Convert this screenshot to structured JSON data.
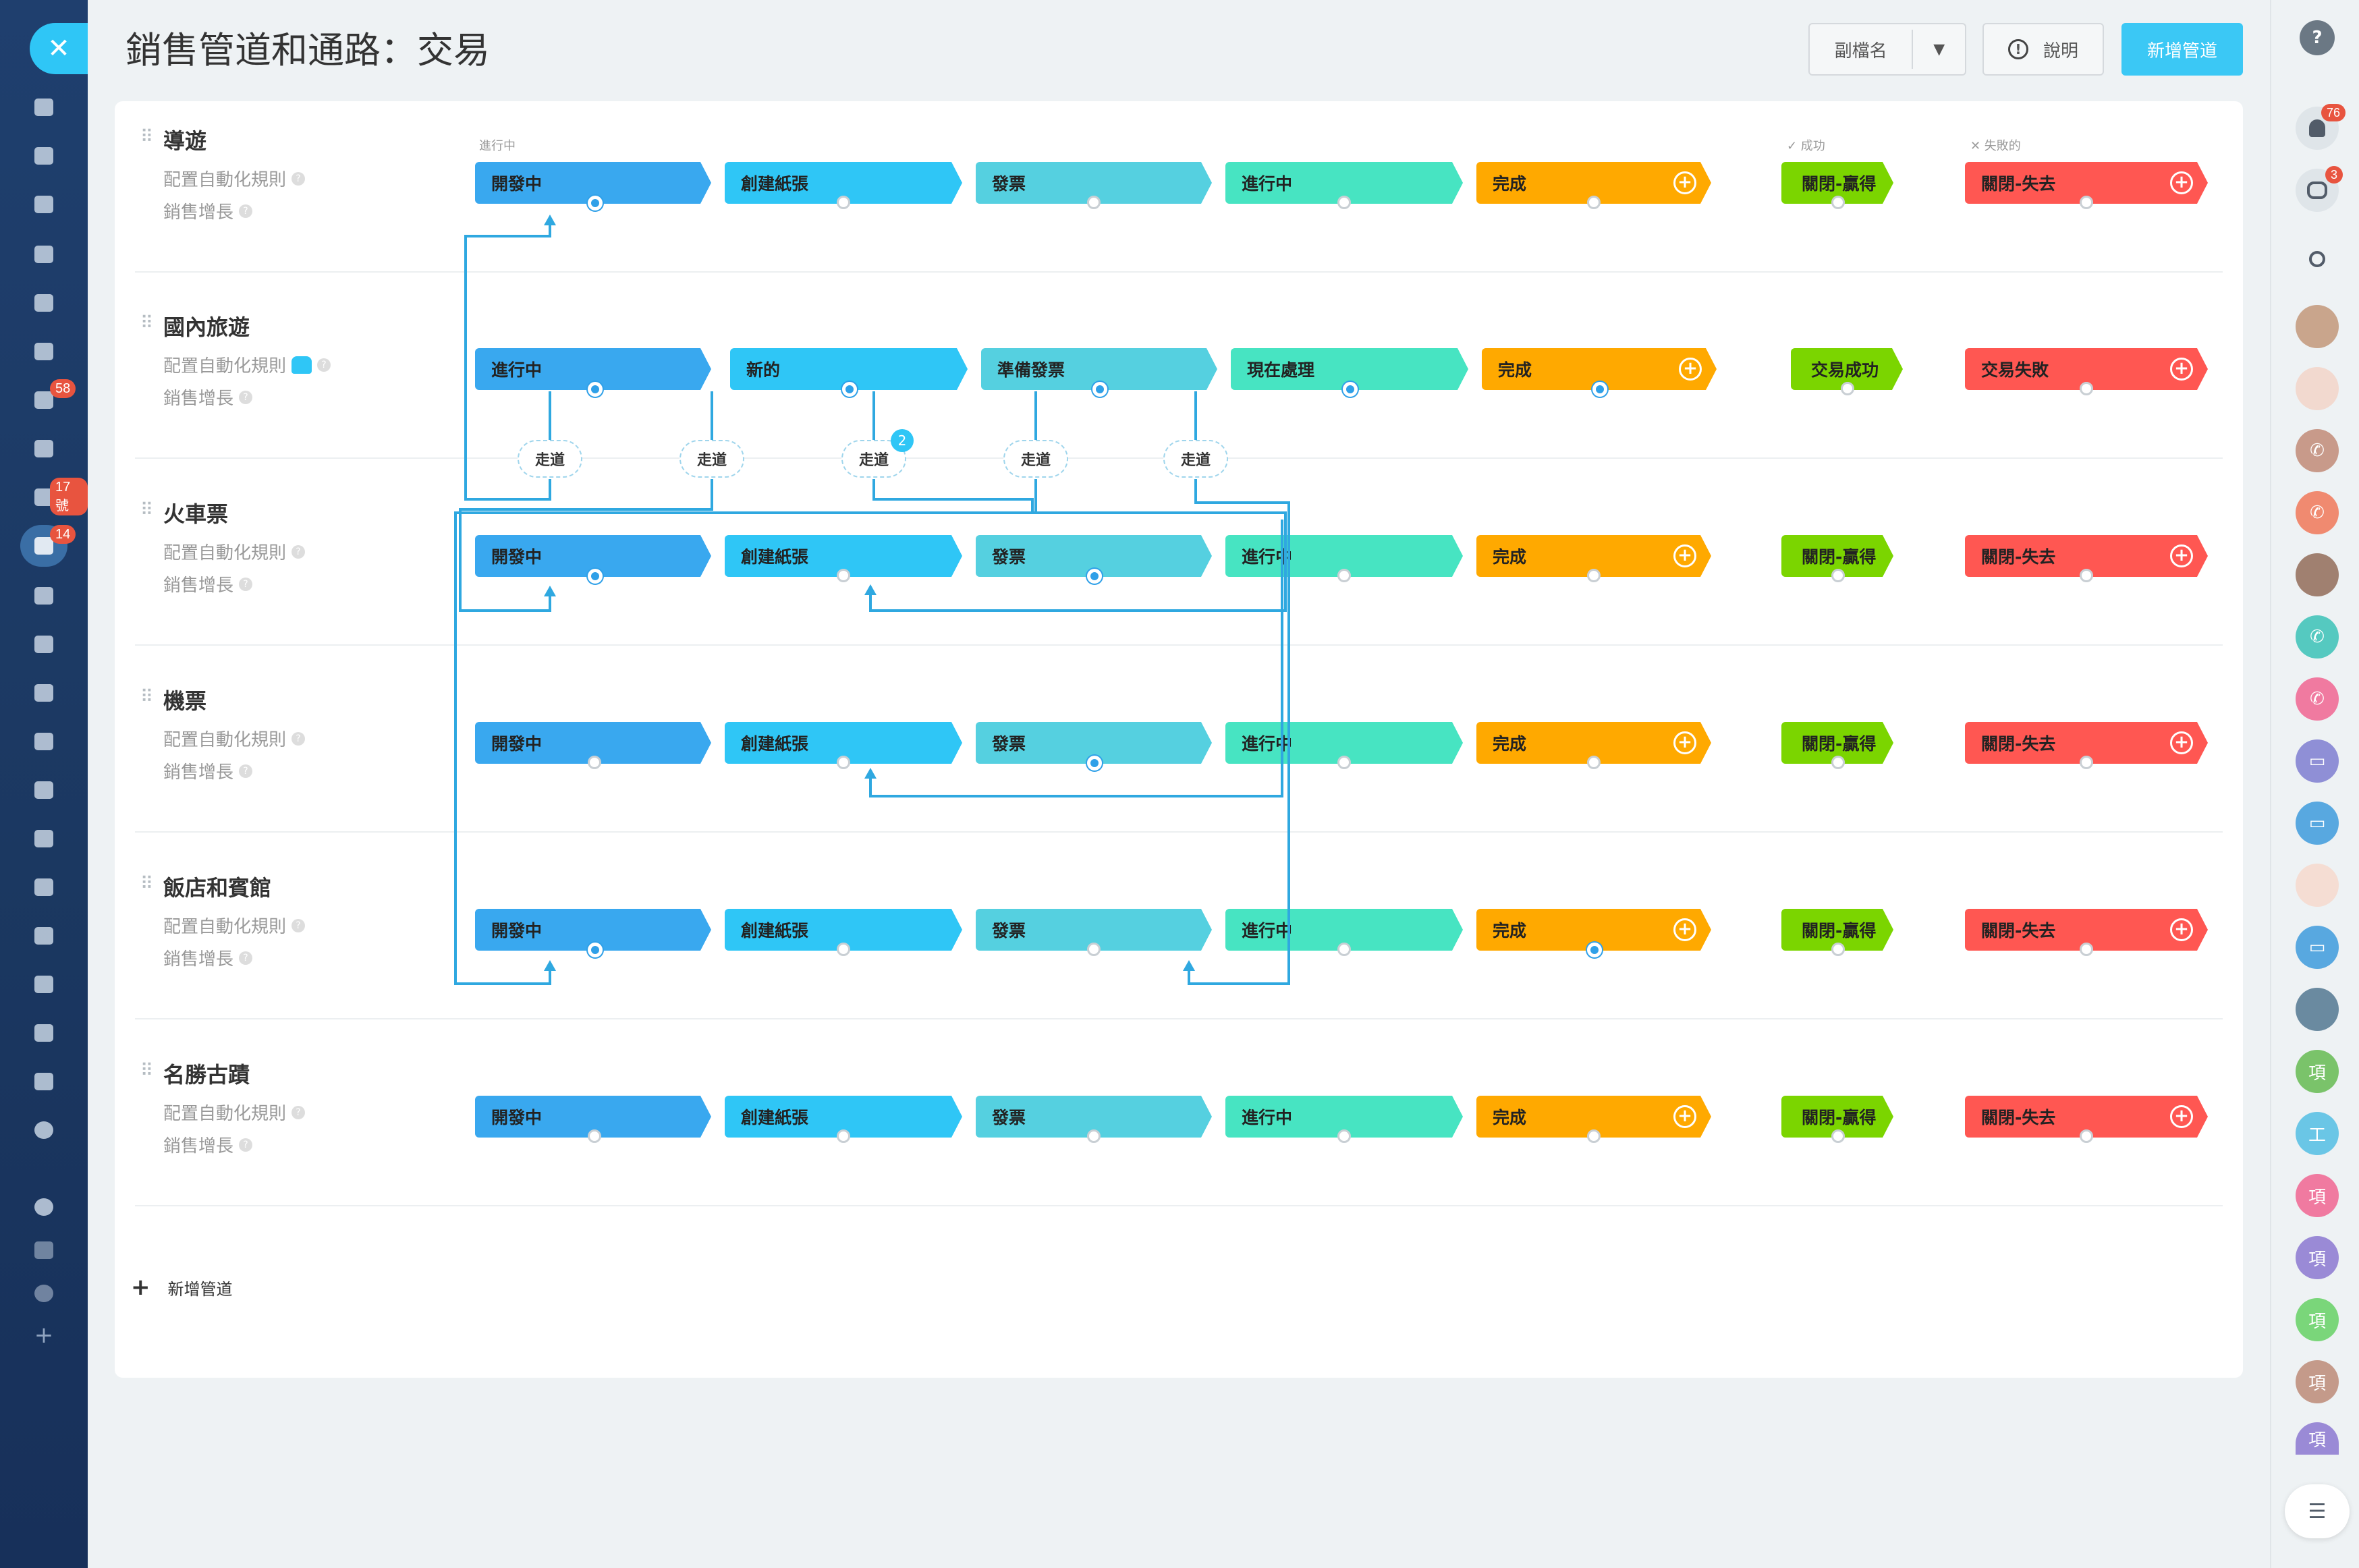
{
  "title": "銷售管道和通路：交易",
  "header": {
    "subname_label": "副檔名",
    "help_label": "說明",
    "add_pipeline_label": "新增管道",
    "help_icon_char": "!",
    "caret_char": "▼"
  },
  "leftnav": {
    "close_icon": "close-icon",
    "badges": {
      "mail": "58",
      "tasks": "17 號",
      "pipeline": "14"
    }
  },
  "columns": {
    "in_progress": "進行中",
    "success": "✓ 成功",
    "failed": "✕ 失敗的"
  },
  "pipelines": [
    {
      "name": "導遊",
      "automation": "配置自動化規則",
      "growth": "銷售增長",
      "stages": [
        "開發中",
        "創建紙張",
        "發票",
        "進行中",
        "完成"
      ],
      "success": "關閉-贏得",
      "fail": "關閉-失去"
    },
    {
      "name": "國內旅遊",
      "automation": "配置自動化規則",
      "growth": "銷售增長",
      "stages": [
        "進行中",
        "新的",
        "準備發票",
        "現在處理",
        "完成"
      ],
      "success": "交易成功",
      "fail": "交易失敗"
    },
    {
      "name": "火車票",
      "automation": "配置自動化規則",
      "growth": "銷售增長",
      "stages": [
        "開發中",
        "創建紙張",
        "發票",
        "進行中",
        "完成"
      ],
      "success": "關閉-贏得",
      "fail": "關閉-失去"
    },
    {
      "name": "機票",
      "automation": "配置自動化規則",
      "growth": "銷售增長",
      "stages": [
        "開發中",
        "創建紙張",
        "發票",
        "進行中",
        "完成"
      ],
      "success": "關閉-贏得",
      "fail": "關閉-失去"
    },
    {
      "name": "飯店和賓館",
      "automation": "配置自動化規則",
      "growth": "銷售增長",
      "stages": [
        "開發中",
        "創建紙張",
        "發票",
        "進行中",
        "完成"
      ],
      "success": "關閉-贏得",
      "fail": "關閉-失去"
    },
    {
      "name": "名勝古蹟",
      "automation": "配置自動化規則",
      "growth": "銷售增長",
      "stages": [
        "開發中",
        "創建紙張",
        "發票",
        "進行中",
        "完成"
      ],
      "success": "關閉-贏得",
      "fail": "關閉-失去"
    }
  ],
  "tunnel_label": "走道",
  "tunnel_count": "2",
  "add_pipeline_bottom": "新增管道",
  "rightbar": {
    "notifications": "76",
    "chats": "3",
    "contact_letters": [
      "項",
      "工",
      "項",
      "項",
      "項",
      "項",
      "項"
    ]
  },
  "colors": {
    "stage1": "#39a8ef",
    "stage2": "#2fc6f6",
    "stage3": "#55d0e0",
    "stage4": "#47e4c2",
    "done": "#ffa900",
    "won": "#7bd500",
    "lost": "#ff5752",
    "accent": "#2fc6f6"
  }
}
